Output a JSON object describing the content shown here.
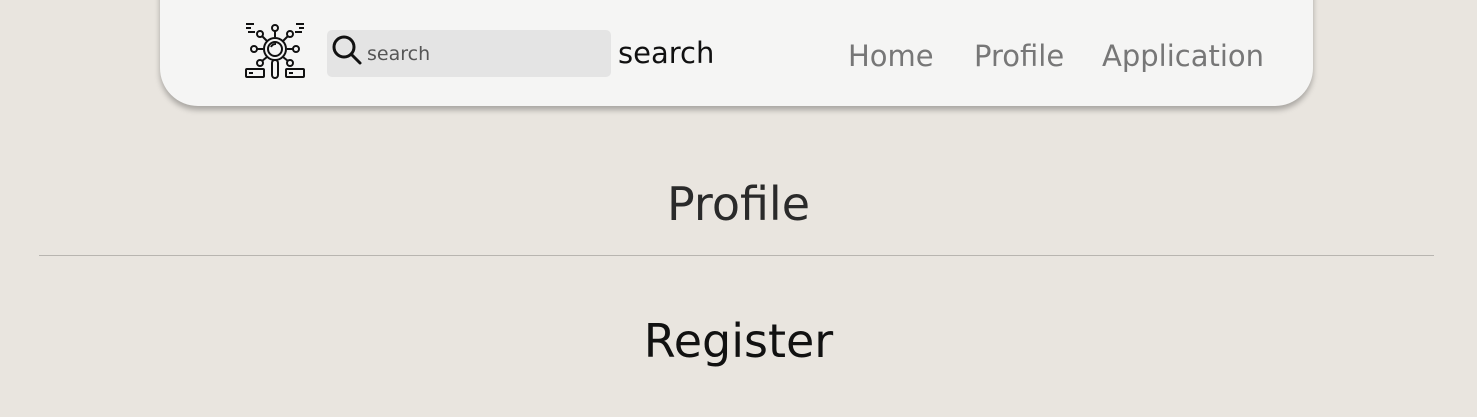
{
  "nav": {
    "logo_icon": "network-search-logo-icon",
    "search_icon": "search-icon",
    "search_placeholder": "search",
    "search_button_label": "search",
    "links": [
      {
        "label": "Home"
      },
      {
        "label": "Profile"
      },
      {
        "label": "Application"
      }
    ]
  },
  "main": {
    "page_title": "Profile",
    "section_title": "Register"
  },
  "colors": {
    "background": "#e9e5df",
    "navbar": "#f5f5f4",
    "search_field": "#e4e4e4",
    "nav_link": "#777777"
  }
}
